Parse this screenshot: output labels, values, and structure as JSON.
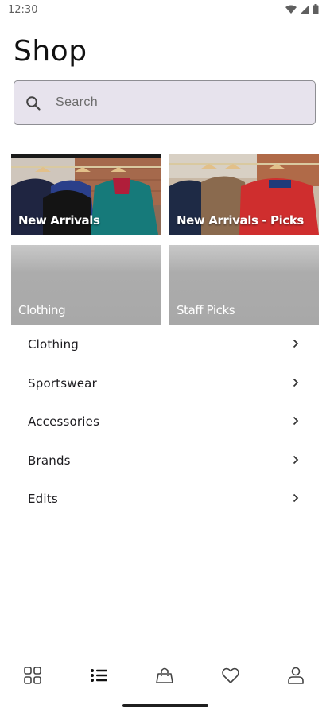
{
  "status_bar": {
    "time": "12:30",
    "icons": [
      "wifi-icon",
      "signal-icon",
      "battery-icon"
    ]
  },
  "header": {
    "title": "Shop"
  },
  "search": {
    "placeholder": "Search",
    "value": ""
  },
  "tiles": [
    {
      "label": "New Arrivals",
      "style": "photo"
    },
    {
      "label": "New Arrivals - Picks",
      "style": "photo"
    },
    {
      "label": "Clothing",
      "style": "gray"
    },
    {
      "label": "Staff Picks",
      "style": "gray"
    }
  ],
  "categories": [
    {
      "label": "Clothing"
    },
    {
      "label": "Sportswear"
    },
    {
      "label": "Accessories"
    },
    {
      "label": "Brands"
    },
    {
      "label": "Edits"
    }
  ],
  "bottom_nav": {
    "items": [
      {
        "icon": "grid-icon",
        "active": false
      },
      {
        "icon": "list-icon",
        "active": true
      },
      {
        "icon": "shopping-bag-icon",
        "active": false
      },
      {
        "icon": "heart-icon",
        "active": false
      },
      {
        "icon": "profile-icon",
        "active": false
      }
    ]
  },
  "colors": {
    "search_bg": "#e7e3ed",
    "tile_gray": "#a9a9a9",
    "text_primary": "#1c1b1f"
  }
}
